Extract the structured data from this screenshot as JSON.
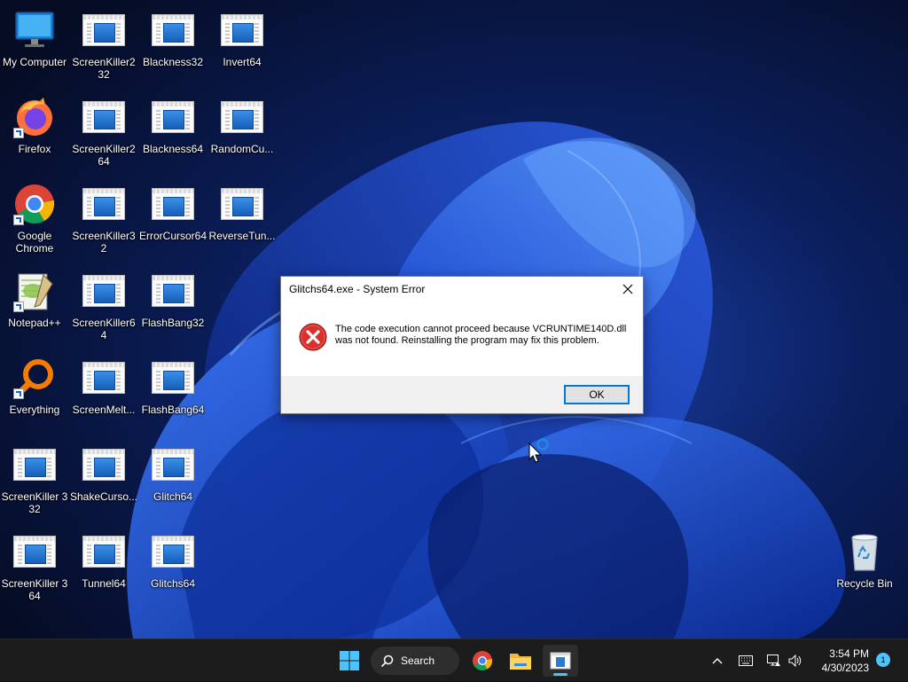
{
  "desktop": {
    "icons": [
      {
        "label": "My Computer",
        "icon": "monitor-icon"
      },
      {
        "label": "ScreenKiller2 32",
        "icon": "program-icon"
      },
      {
        "label": "Blackness32",
        "icon": "program-icon"
      },
      {
        "label": "Invert64",
        "icon": "program-icon"
      },
      {
        "label": "Firefox",
        "icon": "firefox-icon"
      },
      {
        "label": "ScreenKiller2 64",
        "icon": "program-icon"
      },
      {
        "label": "Blackness64",
        "icon": "program-icon"
      },
      {
        "label": "RandomCu...",
        "icon": "program-icon"
      },
      {
        "label": "Google Chrome",
        "icon": "chrome-icon"
      },
      {
        "label": "ScreenKiller32",
        "icon": "program-icon"
      },
      {
        "label": "ErrorCursor64",
        "icon": "program-icon"
      },
      {
        "label": "ReverseTun...",
        "icon": "program-icon"
      },
      {
        "label": "Notepad++",
        "icon": "notepad-plus-plus-icon"
      },
      {
        "label": "ScreenKiller64",
        "icon": "program-icon"
      },
      {
        "label": "FlashBang32",
        "icon": "program-icon"
      },
      {
        "label": "Everything",
        "icon": "everything-search-icon"
      },
      {
        "label": "ScreenMelt...",
        "icon": "program-icon"
      },
      {
        "label": "FlashBang64",
        "icon": "program-icon"
      },
      {
        "label": "ScreenKiller 3 32",
        "icon": "program-icon"
      },
      {
        "label": "ShakeCurso...",
        "icon": "program-icon"
      },
      {
        "label": "Glitch64",
        "icon": "program-icon"
      },
      {
        "label": "ScreenKiller 3 64",
        "icon": "program-icon"
      },
      {
        "label": "Tunnel64",
        "icon": "program-icon"
      },
      {
        "label": "Glitchs64",
        "icon": "program-icon"
      },
      {
        "label": "Recycle Bin",
        "icon": "recycle-bin-icon"
      }
    ]
  },
  "dialog": {
    "title": "Glitchs64.exe - System Error",
    "message": "The code execution cannot proceed because VCRUNTIME140D.dll was not found. Reinstalling the program may fix this problem.",
    "ok_label": "OK",
    "icon": "error-icon"
  },
  "taskbar": {
    "search_label": "Search",
    "time": "3:54 PM",
    "date": "4/30/2023",
    "notification_count": "1",
    "pinned": [
      "start-icon",
      "chrome-icon",
      "file-explorer-icon",
      "glitchs64-icon"
    ],
    "tray": [
      "chevron-up-icon",
      "keyboard-icon",
      "network-icon",
      "volume-icon"
    ],
    "accent_color": "#4cc2ff"
  }
}
